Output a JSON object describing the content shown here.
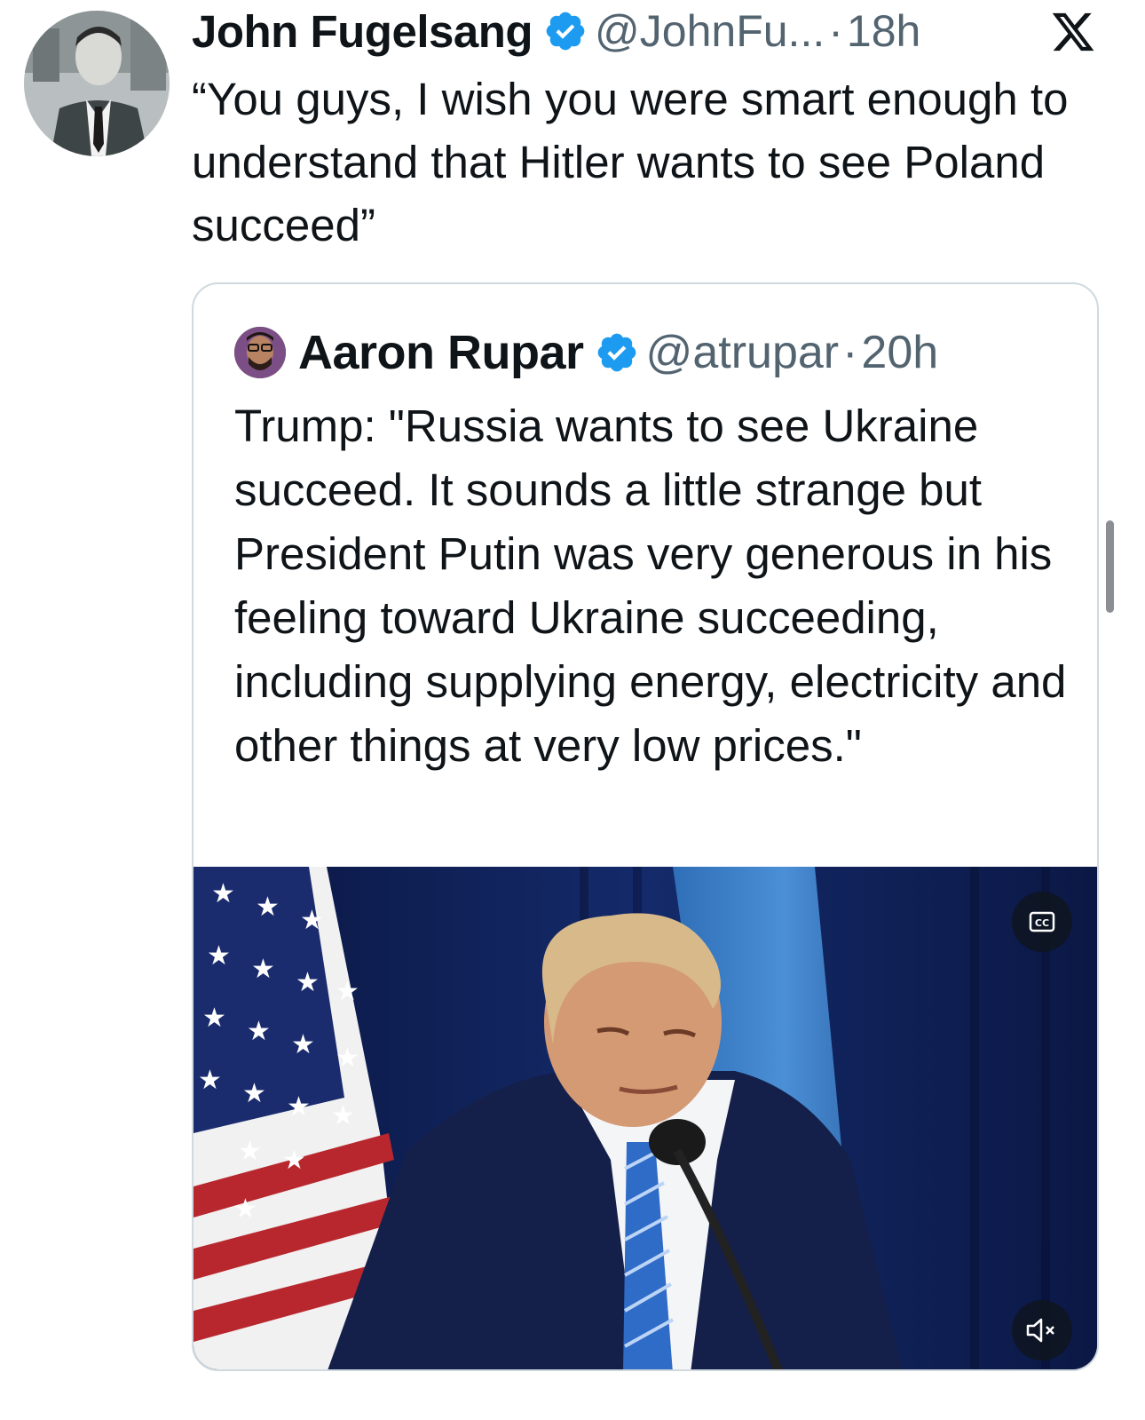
{
  "tweet": {
    "author_name": "John Fugelsang",
    "handle": "@JohnFu...",
    "separator": "·",
    "time": "18h",
    "text": "“You guys, I wish you were smart enough to understand that Hitler wants to see Poland succeed”",
    "verified_icon": "verified-badge-icon",
    "platform_icon": "x-logo-icon"
  },
  "quoted_tweet": {
    "author_name": "Aaron Rupar",
    "handle": "@atrupar",
    "separator": "·",
    "time": "20h",
    "text": "Trump: \"Russia wants to see Ukraine succeed. It sounds a little strange but President Putin was very generous in his feeling toward Ukraine succeeding, including supplying energy, electricity and other things at very low prices.\"",
    "media": {
      "type": "video",
      "cc_icon": "closed-captions-icon",
      "mute_icon": "speaker-muted-icon"
    }
  },
  "colors": {
    "verified_blue": "#1d9bf0",
    "text_primary": "#0f1419",
    "text_secondary": "#536471",
    "card_border": "#cfd9de"
  }
}
